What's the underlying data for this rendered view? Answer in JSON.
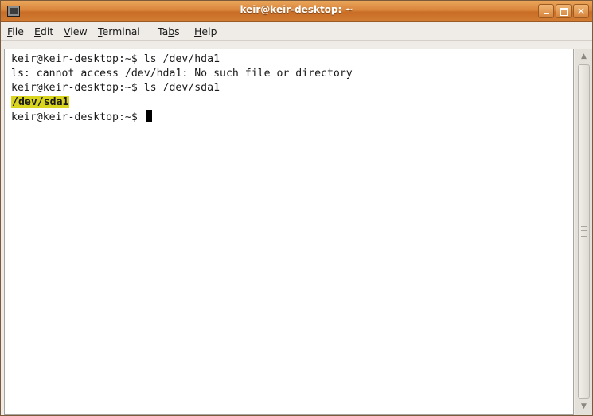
{
  "window": {
    "title": "keir@keir-desktop: ~"
  },
  "menubar": {
    "items": [
      {
        "mnemonic": "F",
        "rest": "ile"
      },
      {
        "mnemonic": "E",
        "rest": "dit"
      },
      {
        "mnemonic": "V",
        "rest": "iew"
      },
      {
        "mnemonic": "T",
        "rest": "erminal"
      },
      {
        "pre": "Ta",
        "mnemonic": "b",
        "rest": "s"
      },
      {
        "mnemonic": "H",
        "rest": "elp"
      }
    ]
  },
  "terminal": {
    "lines": [
      "keir@keir-desktop:~$ ls /dev/hda1",
      "ls: cannot access /dev/hda1: No such file or directory",
      "keir@keir-desktop:~$ ls /dev/sda1",
      "/dev/sda1",
      "keir@keir-desktop:~$ "
    ],
    "highlight_color": "#d9d51e"
  },
  "colors": {
    "titlebar": "#d9843a",
    "title_text": "#ffffff",
    "terminal_bg": "#ffffff"
  },
  "icons": {
    "app": "terminal-icon",
    "minimize": "minimize-icon",
    "maximize": "maximize-icon",
    "close": "close-icon",
    "scroll_up": "scroll-up-arrow-icon",
    "scroll_down": "scroll-down-arrow-icon"
  }
}
